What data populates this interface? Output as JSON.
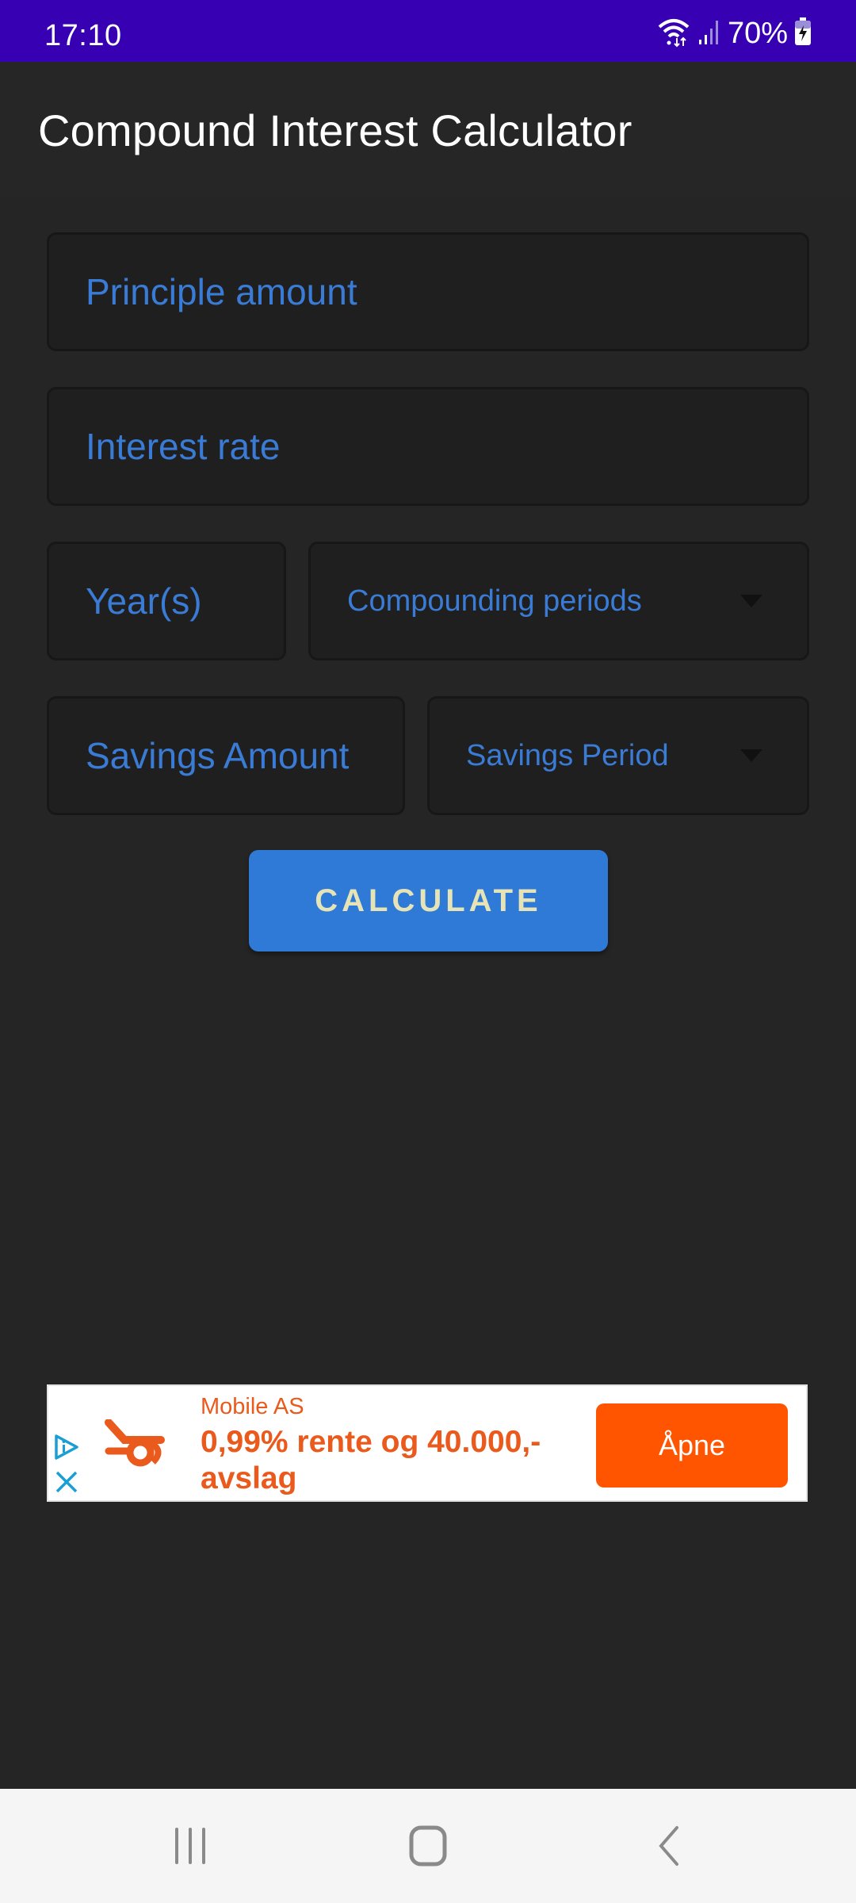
{
  "status_bar": {
    "time": "17:10",
    "battery_percent": "70%",
    "icons": [
      "wifi-icon",
      "signal-icon",
      "battery-charging-icon"
    ]
  },
  "app_bar": {
    "title": "Compound Interest Calculator"
  },
  "form": {
    "principal": {
      "placeholder": "Principle amount",
      "value": ""
    },
    "interest_rate": {
      "placeholder": "Interest rate",
      "value": ""
    },
    "years": {
      "placeholder": "Year(s)",
      "value": ""
    },
    "compounding_periods": {
      "selected": "Compounding periods"
    },
    "savings_amount": {
      "placeholder": "Savings Amount",
      "value": ""
    },
    "savings_period": {
      "selected": "Savings Period"
    },
    "calculate_label": "CALCULATE"
  },
  "ad": {
    "advertiser": "Mobile AS",
    "headline": "0,99% rente og 40.000,- avslag",
    "cta_label": "Åpne",
    "colors": {
      "brand": "#ea5a1c",
      "cta": "#ff5500"
    }
  },
  "nav_bar": {
    "buttons": [
      "recent-apps",
      "home",
      "back"
    ]
  },
  "colors": {
    "status_bar": "#3700b3",
    "background": "#252525",
    "accent": "#2e7ad6",
    "hint": "#3a7bd5"
  }
}
